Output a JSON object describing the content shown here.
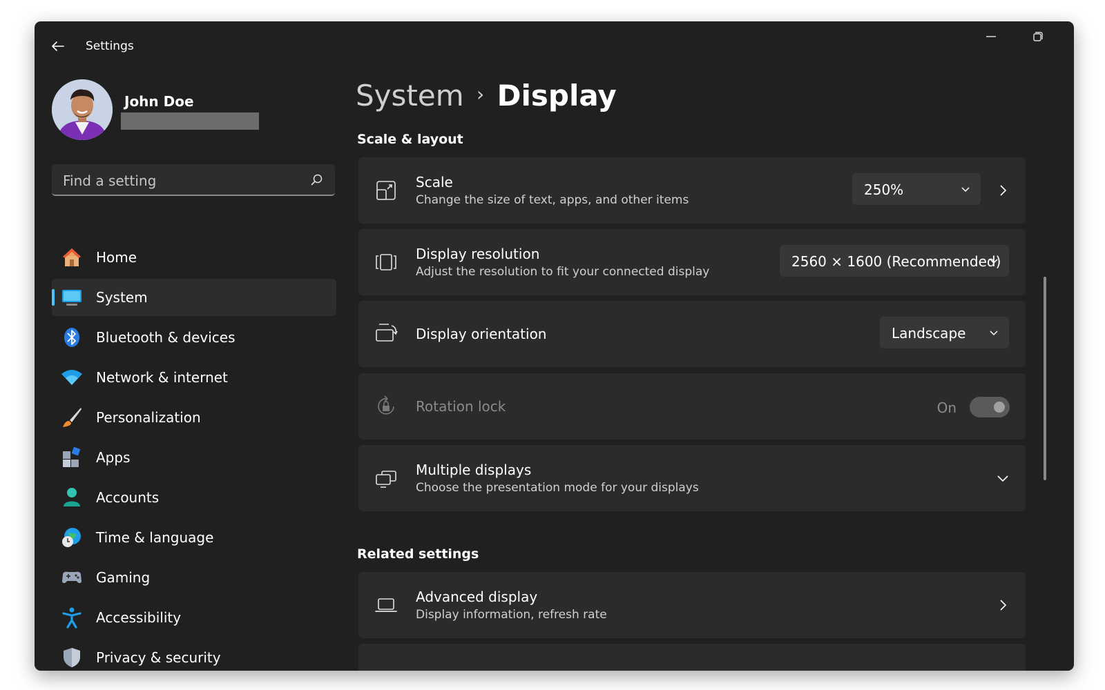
{
  "window": {
    "title": "Settings"
  },
  "profile": {
    "name": "John Doe"
  },
  "search": {
    "placeholder": "Find a setting"
  },
  "nav": {
    "items": [
      {
        "label": "Home",
        "icon": "home-icon"
      },
      {
        "label": "System",
        "icon": "system-icon",
        "active": true
      },
      {
        "label": "Bluetooth & devices",
        "icon": "bluetooth-icon"
      },
      {
        "label": "Network & internet",
        "icon": "wifi-icon"
      },
      {
        "label": "Personalization",
        "icon": "paintbrush-icon"
      },
      {
        "label": "Apps",
        "icon": "apps-icon"
      },
      {
        "label": "Accounts",
        "icon": "person-icon"
      },
      {
        "label": "Time & language",
        "icon": "globe-clock-icon"
      },
      {
        "label": "Gaming",
        "icon": "gamepad-icon"
      },
      {
        "label": "Accessibility",
        "icon": "accessibility-icon"
      },
      {
        "label": "Privacy & security",
        "icon": "shield-icon"
      }
    ]
  },
  "breadcrumb": {
    "parent": "System",
    "separator": "›",
    "current": "Display"
  },
  "sections": {
    "scale_layout": "Scale & layout",
    "related": "Related settings"
  },
  "scale": {
    "title": "Scale",
    "description": "Change the size of text, apps, and other items",
    "value": "250%"
  },
  "resolution": {
    "title": "Display resolution",
    "description": "Adjust the resolution to fit your connected display",
    "value": "2560 × 1600 (Recommended)"
  },
  "orientation": {
    "title": "Display orientation",
    "value": "Landscape"
  },
  "rotation_lock": {
    "title": "Rotation lock",
    "state_label": "On",
    "enabled": false
  },
  "multiple_displays": {
    "title": "Multiple displays",
    "description": "Choose the presentation mode for your displays"
  },
  "advanced_display": {
    "title": "Advanced display",
    "description": "Display information, refresh rate"
  },
  "colors": {
    "window_bg": "#202020",
    "card_bg": "#2b2b2b",
    "accent": "#4cc2ff"
  }
}
